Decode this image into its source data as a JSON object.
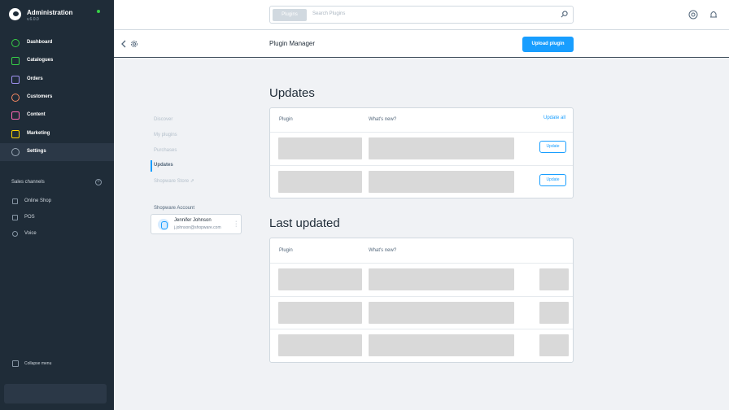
{
  "app": {
    "title": "Administration",
    "version": "v.6.0.0"
  },
  "sidebar": {
    "items": [
      {
        "label": "Dashboard"
      },
      {
        "label": "Catalogues"
      },
      {
        "label": "Orders"
      },
      {
        "label": "Customers"
      },
      {
        "label": "Content"
      },
      {
        "label": "Marketing"
      },
      {
        "label": "Settings"
      }
    ],
    "sales_channels_title": "Sales channels",
    "sales_channels": [
      {
        "label": "Online Shop"
      },
      {
        "label": "POS"
      },
      {
        "label": "Voice"
      }
    ],
    "collapse_label": "Collapse menu"
  },
  "search": {
    "type_label": "Plugins",
    "placeholder": "Search Plugins"
  },
  "smart_bar": {
    "title": "Plugin Manager",
    "upload_label": "Upload plugin"
  },
  "plugin_nav": {
    "items": [
      {
        "label": "Discover"
      },
      {
        "label": "My plugins"
      },
      {
        "label": "Purchases"
      },
      {
        "label": "Updates"
      },
      {
        "label": "Shopware Store ⇗"
      }
    ],
    "account_title": "Shopware Account",
    "account_name": "Jennifer Johnson",
    "account_email": "j.johnson@shopware.com"
  },
  "updates": {
    "title": "Updates",
    "col_plugin": "Plugin",
    "col_whats_new": "What's new?",
    "update_all": "Update all",
    "update_label": "Update"
  },
  "last_updated": {
    "title": "Last updated",
    "col_plugin": "Plugin",
    "col_whats_new": "What's new?"
  },
  "colors": {
    "accent": "#189eff",
    "sidebar_bg": "#1f2c38",
    "status_online": "#37d046"
  }
}
